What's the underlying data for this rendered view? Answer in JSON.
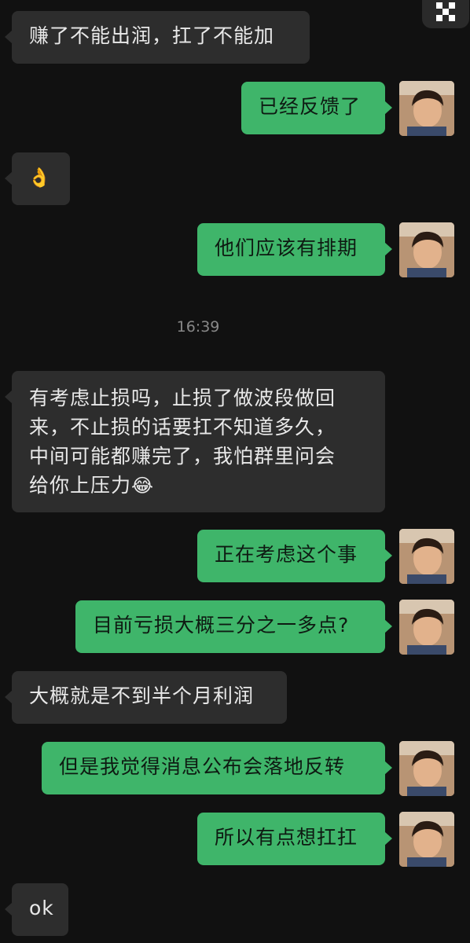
{
  "messages": {
    "m1": "赚了不能出润，扛了不能加",
    "m2": "已经反馈了",
    "m3": "👌",
    "m4": "他们应该有排期",
    "time": "16:39",
    "m5_line1": "有考虑止损吗，止损了做波段做回",
    "m5_line2": "来，不止损的话要扛不知道多久，",
    "m5_line3": "中间可能都赚完了，我怕群里问会",
    "m5_line4": "给你上压力",
    "m5_emoji": "😂",
    "m6": "正在考虑这个事",
    "m7": "目前亏损大概三分之一多点?",
    "m8": "大概就是不到半个月利润",
    "m9": "但是我觉得消息公布会落地反转",
    "m10": "所以有点想扛扛",
    "m11": "ok"
  },
  "colors": {
    "background": "#111111",
    "incoming_bubble": "#2d2d2d",
    "outgoing_bubble": "#3fb56a"
  }
}
